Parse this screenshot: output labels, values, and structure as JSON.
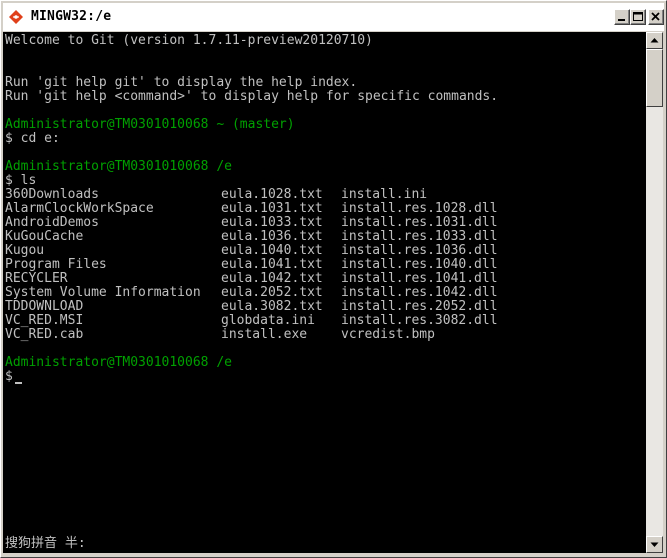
{
  "window": {
    "title": "MINGW32:/e",
    "icon": "git-diamond-icon",
    "controls": {
      "minimize": "minimize-icon",
      "maximize": "maximize-icon",
      "close": "close-icon"
    }
  },
  "console": {
    "welcome": "Welcome to Git (version 1.7.11-preview20120710)",
    "help1": "Run 'git help git' to display the help index.",
    "help2": "Run 'git help <command>' to display help for specific commands.",
    "prompt1": "Administrator@TM0301010068 ~ (master)",
    "cmd1": "$ cd e:",
    "prompt2": "Administrator@TM0301010068 /e",
    "cmd2": "$ ls",
    "listing": [
      [
        "360Downloads",
        "eula.1028.txt",
        "install.ini"
      ],
      [
        "AlarmClockWorkSpace",
        "eula.1031.txt",
        "install.res.1028.dll"
      ],
      [
        "AndroidDemos",
        "eula.1033.txt",
        "install.res.1031.dll"
      ],
      [
        "KuGouCache",
        "eula.1036.txt",
        "install.res.1033.dll"
      ],
      [
        "Kugou",
        "eula.1040.txt",
        "install.res.1036.dll"
      ],
      [
        "Program Files",
        "eula.1041.txt",
        "install.res.1040.dll"
      ],
      [
        "RECYCLER",
        "eula.1042.txt",
        "install.res.1041.dll"
      ],
      [
        "System Volume Information",
        "eula.2052.txt",
        "install.res.1042.dll"
      ],
      [
        "TDDOWNLOAD",
        "eula.3082.txt",
        "install.res.2052.dll"
      ],
      [
        "VC_RED.MSI",
        "globdata.ini",
        "install.res.3082.dll"
      ],
      [
        "VC_RED.cab",
        "install.exe",
        "vcredist.bmp"
      ]
    ],
    "prompt3": "Administrator@TM0301010068 /e",
    "cmd3": "$",
    "ime_status": "搜狗拼音 半:"
  },
  "colors": {
    "background": "#000000",
    "text": "#c0c0c0",
    "prompt": "#00a000",
    "titlebar": "#ffffff",
    "chrome": "#d4d0c8"
  }
}
